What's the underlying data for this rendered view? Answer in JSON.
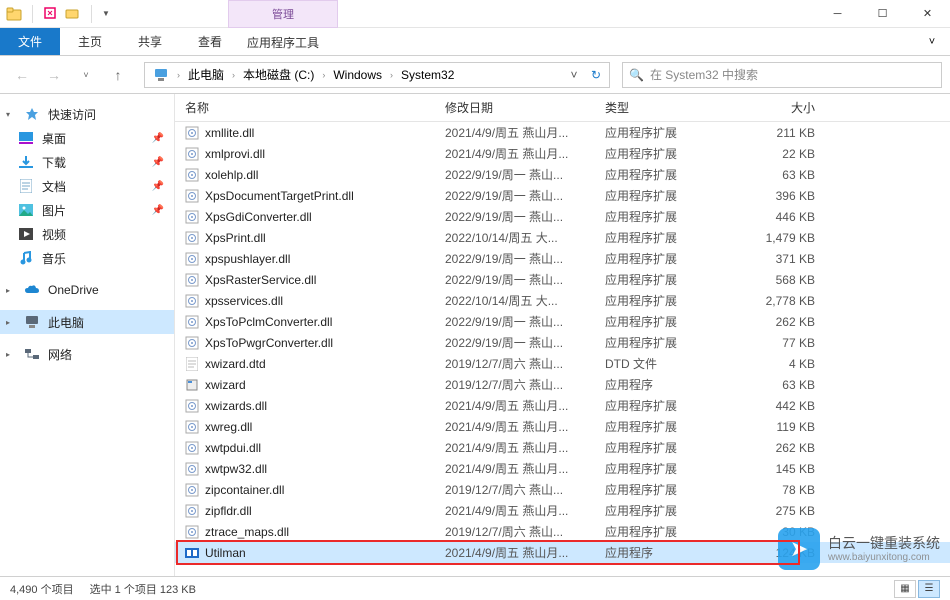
{
  "window": {
    "title": "System32",
    "ctx_header": "管理"
  },
  "ribbon": {
    "file": "文件",
    "home": "主页",
    "share": "共享",
    "view": "查看",
    "ctx_tab": "应用程序工具"
  },
  "nav": {
    "breadcrumb": [
      "此电脑",
      "本地磁盘 (C:)",
      "Windows",
      "System32"
    ],
    "search_placeholder": "在 System32 中搜索"
  },
  "navpane": {
    "quick": {
      "label": "快速访问",
      "items": [
        {
          "label": "桌面",
          "icon": "desktop",
          "pinned": true
        },
        {
          "label": "下载",
          "icon": "download",
          "pinned": true
        },
        {
          "label": "文档",
          "icon": "doc",
          "pinned": true
        },
        {
          "label": "图片",
          "icon": "pic",
          "pinned": true
        },
        {
          "label": "视频",
          "icon": "video",
          "pinned": false
        },
        {
          "label": "音乐",
          "icon": "music",
          "pinned": false
        }
      ]
    },
    "onedrive": "OneDrive",
    "pc": "此电脑",
    "network": "网络"
  },
  "columns": {
    "name": "名称",
    "date": "修改日期",
    "type": "类型",
    "size": "大小"
  },
  "files": [
    {
      "name": "xmllite.dll",
      "date": "2021/4/9/周五 燕山月...",
      "type": "应用程序扩展",
      "size": "211 KB",
      "icon": "dll"
    },
    {
      "name": "xmlprovi.dll",
      "date": "2021/4/9/周五 燕山月...",
      "type": "应用程序扩展",
      "size": "22 KB",
      "icon": "dll"
    },
    {
      "name": "xolehlp.dll",
      "date": "2022/9/19/周一 燕山...",
      "type": "应用程序扩展",
      "size": "63 KB",
      "icon": "dll"
    },
    {
      "name": "XpsDocumentTargetPrint.dll",
      "date": "2022/9/19/周一 燕山...",
      "type": "应用程序扩展",
      "size": "396 KB",
      "icon": "dll"
    },
    {
      "name": "XpsGdiConverter.dll",
      "date": "2022/9/19/周一 燕山...",
      "type": "应用程序扩展",
      "size": "446 KB",
      "icon": "dll"
    },
    {
      "name": "XpsPrint.dll",
      "date": "2022/10/14/周五 大...",
      "type": "应用程序扩展",
      "size": "1,479 KB",
      "icon": "dll"
    },
    {
      "name": "xpspushlayer.dll",
      "date": "2022/9/19/周一 燕山...",
      "type": "应用程序扩展",
      "size": "371 KB",
      "icon": "dll"
    },
    {
      "name": "XpsRasterService.dll",
      "date": "2022/9/19/周一 燕山...",
      "type": "应用程序扩展",
      "size": "568 KB",
      "icon": "dll"
    },
    {
      "name": "xpsservices.dll",
      "date": "2022/10/14/周五 大...",
      "type": "应用程序扩展",
      "size": "2,778 KB",
      "icon": "dll"
    },
    {
      "name": "XpsToPclmConverter.dll",
      "date": "2022/9/19/周一 燕山...",
      "type": "应用程序扩展",
      "size": "262 KB",
      "icon": "dll"
    },
    {
      "name": "XpsToPwgrConverter.dll",
      "date": "2022/9/19/周一 燕山...",
      "type": "应用程序扩展",
      "size": "77 KB",
      "icon": "dll"
    },
    {
      "name": "xwizard.dtd",
      "date": "2019/12/7/周六 燕山...",
      "type": "DTD 文件",
      "size": "4 KB",
      "icon": "dtd"
    },
    {
      "name": "xwizard",
      "date": "2019/12/7/周六 燕山...",
      "type": "应用程序",
      "size": "63 KB",
      "icon": "exe"
    },
    {
      "name": "xwizards.dll",
      "date": "2021/4/9/周五 燕山月...",
      "type": "应用程序扩展",
      "size": "442 KB",
      "icon": "dll"
    },
    {
      "name": "xwreg.dll",
      "date": "2021/4/9/周五 燕山月...",
      "type": "应用程序扩展",
      "size": "119 KB",
      "icon": "dll"
    },
    {
      "name": "xwtpdui.dll",
      "date": "2021/4/9/周五 燕山月...",
      "type": "应用程序扩展",
      "size": "262 KB",
      "icon": "dll"
    },
    {
      "name": "xwtpw32.dll",
      "date": "2021/4/9/周五 燕山月...",
      "type": "应用程序扩展",
      "size": "145 KB",
      "icon": "dll"
    },
    {
      "name": "zipcontainer.dll",
      "date": "2019/12/7/周六 燕山...",
      "type": "应用程序扩展",
      "size": "78 KB",
      "icon": "dll"
    },
    {
      "name": "zipfldr.dll",
      "date": "2021/4/9/周五 燕山月...",
      "type": "应用程序扩展",
      "size": "275 KB",
      "icon": "dll"
    },
    {
      "name": "ztrace_maps.dll",
      "date": "2019/12/7/周六 燕山...",
      "type": "应用程序扩展",
      "size": "30 KB",
      "icon": "dll"
    },
    {
      "name": "Utilman",
      "date": "2021/4/9/周五 燕山月...",
      "type": "应用程序",
      "size": "124 KB",
      "icon": "util",
      "selected": true,
      "highlight": true
    }
  ],
  "status": {
    "count": "4,490 个项目",
    "sel": "选中 1 个项目  123 KB"
  },
  "watermark": {
    "brand": "白云一键重装系统",
    "url": "www.baiyunxitong.com"
  }
}
